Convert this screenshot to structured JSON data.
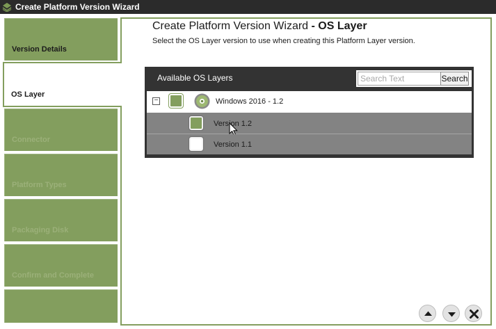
{
  "window": {
    "title": "Create Platform Version Wizard"
  },
  "steps": [
    {
      "label": "Version Details",
      "state": "done"
    },
    {
      "label": "OS Layer",
      "state": "active"
    },
    {
      "label": "Connector",
      "state": "disabled"
    },
    {
      "label": "Platform Types",
      "state": "disabled"
    },
    {
      "label": "Packaging Disk",
      "state": "disabled"
    },
    {
      "label": "Confirm and Complete",
      "state": "disabled"
    },
    {
      "label": "",
      "state": "done"
    }
  ],
  "main": {
    "title_prefix": "Create Platform Version Wizard",
    "title_suffix": " - OS Layer",
    "subtitle": "Select the OS Layer version to use when creating this Platform Layer version."
  },
  "layers": {
    "title": "Available OS Layers",
    "search_placeholder": "Search Text",
    "search_button": "Search",
    "parent": {
      "name": "Windows 2016 - 1.2",
      "checked": true
    },
    "versions": [
      {
        "name": "Version 1.2",
        "checked": true
      },
      {
        "name": "Version 1.1",
        "checked": false
      }
    ]
  },
  "colors": {
    "accent": "#839e5e",
    "titlebar": "#2b2b2b",
    "table_header": "#333333",
    "row_gray": "#838383"
  },
  "icons": {
    "title": "wizard-app-icon",
    "parent": "disc-icon",
    "nav": [
      "arrow-up-icon",
      "arrow-down-icon",
      "close-icon"
    ]
  }
}
